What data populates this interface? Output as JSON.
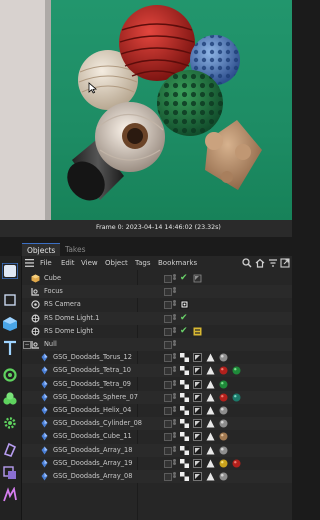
{
  "viewport": {
    "frame_readout": "Frame  0:  2023-04-14  14:46:02  (23.32s)"
  },
  "tabs": [
    {
      "label": "Objects"
    },
    {
      "label": "Takes"
    }
  ],
  "menu": [
    "File",
    "Edit",
    "View",
    "Object",
    "Tags",
    "Bookmarks"
  ],
  "objects": [
    {
      "label": "Cube",
      "icon": "cube-icon",
      "indent": 0,
      "tags": [
        "check",
        "material-blank"
      ]
    },
    {
      "label": "Focus",
      "icon": "null-icon",
      "indent": 0,
      "tags": []
    },
    {
      "label": "RS Camera",
      "icon": "camera-icon",
      "indent": 0,
      "tags": [
        "camera-tag"
      ]
    },
    {
      "label": "RS Dome Light.1",
      "icon": "light-icon",
      "indent": 0,
      "tags": [
        "check"
      ]
    },
    {
      "label": "RS Dome Light",
      "icon": "light-icon",
      "indent": 0,
      "tags": [
        "check",
        "light-tag"
      ]
    },
    {
      "label": "Null",
      "icon": "null-icon",
      "indent": 0,
      "tags": []
    },
    {
      "label": "GSG_Doodads_Torus_12",
      "icon": "doodad-icon",
      "indent": 1,
      "tags": [
        "checker",
        "uv",
        "tri",
        "ball-grey"
      ]
    },
    {
      "label": "GSG_Doodads_Tetra_10",
      "icon": "doodad-icon",
      "indent": 1,
      "tags": [
        "checker",
        "uv",
        "tri",
        "ball-red",
        "ball-green"
      ]
    },
    {
      "label": "GSG_Doodads_Tetra_09",
      "icon": "doodad-icon",
      "indent": 1,
      "tags": [
        "checker",
        "uv",
        "tri",
        "ball-green"
      ]
    },
    {
      "label": "GSG_Doodads_Sphere_07",
      "icon": "doodad-icon",
      "indent": 1,
      "tags": [
        "checker",
        "uv",
        "tri",
        "ball-red",
        "ball-teal"
      ]
    },
    {
      "label": "GSG_Doodads_Helix_04",
      "icon": "doodad-icon",
      "indent": 1,
      "tags": [
        "checker",
        "uv",
        "tri",
        "ball-grey"
      ]
    },
    {
      "label": "GSG_Doodads_Cylinder_08",
      "icon": "doodad-icon",
      "indent": 1,
      "tags": [
        "checker",
        "uv",
        "tri",
        "ball-grey"
      ]
    },
    {
      "label": "GSG_Doodads_Cube_11",
      "icon": "doodad-icon",
      "indent": 1,
      "tags": [
        "checker",
        "uv",
        "tri",
        "ball-tan"
      ]
    },
    {
      "label": "GSG_Doodads_Array_18",
      "icon": "doodad-icon",
      "indent": 1,
      "tags": [
        "checker",
        "uv",
        "tri",
        "ball-grey"
      ]
    },
    {
      "label": "GSG_Doodads_Array_19",
      "icon": "doodad-icon",
      "indent": 1,
      "tags": [
        "checker",
        "uv",
        "tri",
        "ball-yellow",
        "ball-red"
      ]
    },
    {
      "label": "GSG_Doodads_Array_08",
      "icon": "doodad-icon",
      "indent": 1,
      "tags": [
        "checker",
        "uv",
        "tri",
        "ball-grey"
      ]
    }
  ],
  "colors": {
    "viewport_bg": "#1f9169",
    "accent_blue": "#3b6fc4",
    "check_green": "#6ad36a",
    "cube_orange": "#e0a84a"
  }
}
